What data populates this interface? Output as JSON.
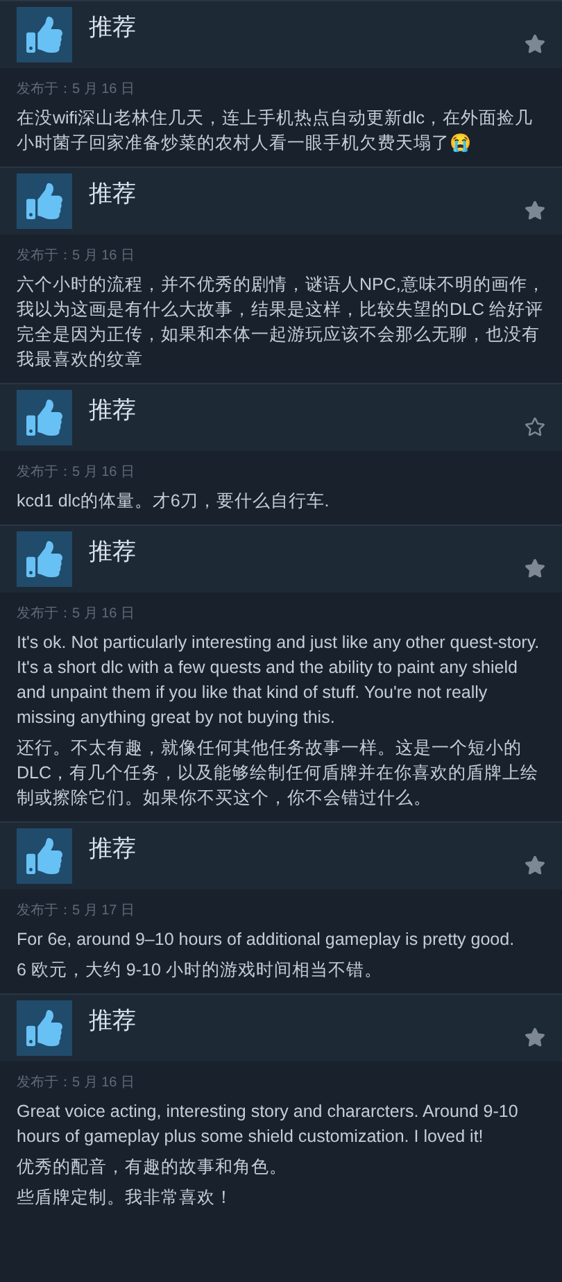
{
  "reviews": [
    {
      "verdict": "推荐",
      "starred": true,
      "date": "发布于：5 月 16 日",
      "paragraphs": [
        "在没wifi深山老林住几天，连上手机热点自动更新dlc，在外面捡几小时菌子回家准备炒菜的农村人看一眼手机欠费天塌了😭"
      ]
    },
    {
      "verdict": "推荐",
      "starred": true,
      "date": "发布于：5 月 16 日",
      "paragraphs": [
        "六个小时的流程，并不优秀的剧情，谜语人NPC,意味不明的画作，我以为这画是有什么大故事，结果是这样，比较失望的DLC 给好评完全是因为正传，如果和本体一起游玩应该不会那么无聊，也没有我最喜欢的纹章"
      ]
    },
    {
      "verdict": "推荐",
      "starred": false,
      "date": "发布于：5 月 16 日",
      "paragraphs": [
        "kcd1 dlc的体量。才6刀，要什么自行车."
      ]
    },
    {
      "verdict": "推荐",
      "starred": true,
      "date": "发布于：5 月 16 日",
      "paragraphs": [
        "It's ok. Not particularly interesting and just like any other quest-story. It's a short dlc with a few quests and the ability to paint any shield and unpaint them if you like that kind of stuff. You're not really missing anything great by not buying this.",
        "还行。不太有趣，就像任何其他任务故事一样。这是一个短小的DLC，有几个任务，以及能够绘制任何盾牌并在你喜欢的盾牌上绘制或擦除它们。如果你不买这个，你不会错过什么。"
      ]
    },
    {
      "verdict": "推荐",
      "starred": true,
      "date": "发布于：5 月 17 日",
      "paragraphs": [
        "For 6e, around 9–10 hours of additional gameplay is pretty good.",
        "6 欧元，大约 9-10 小时的游戏时间相当不错。"
      ]
    },
    {
      "verdict": "推荐",
      "starred": true,
      "date": "发布于：5 月 16 日",
      "paragraphs": [
        "Great voice acting, interesting story and chararcters. Around 9-10 hours of gameplay plus some shield customization. I loved it!",
        "优秀的配音，有趣的故事和角色。",
        "些盾牌定制。我非常喜欢！"
      ]
    }
  ]
}
